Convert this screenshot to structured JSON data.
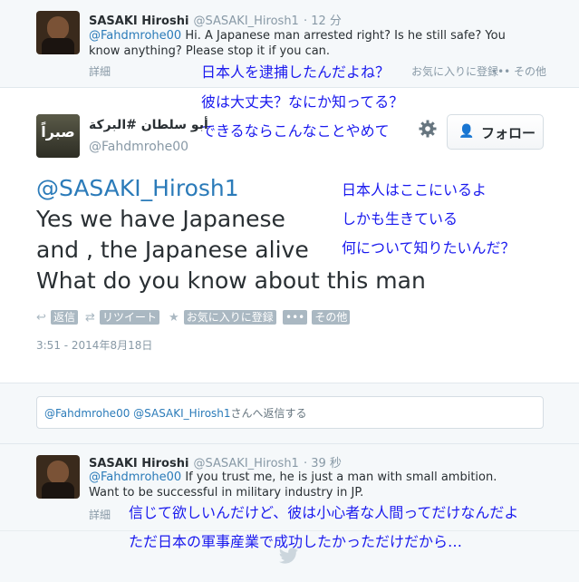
{
  "tweet1": {
    "name": "SASAKI Hiroshi",
    "handle": "@SASAKI_Hirosh1",
    "time": "· 12 分",
    "mention": "@Fahdmrohe00",
    "text": " Hi. A Japanese man arrested right? Is he still safe? You know anything? Please stop it if you can.",
    "details": "詳細",
    "fav_faded": "お気に入りに登録",
    "more_faded": "••• その他"
  },
  "annotation1": [
    "日本人を逮捕したんだよね？",
    "彼は大丈夫？なにか知ってる？",
    "できるならこんなことやめて"
  ],
  "tweet2": {
    "name": "أبو سلطان #البركة",
    "handle": "@Fahdmrohe00",
    "avatar_text": "صبراً",
    "follow_label": "フォロー",
    "mention": "@SASAKI_Hirosh1",
    "lines": [
      "Yes we have Japanese",
      "and , the Japanese alive",
      "What do you know about this man"
    ],
    "actions": {
      "reply": "返信",
      "retweet": "リツイート",
      "favorite": "お気に入りに登録",
      "more": "その他"
    },
    "timestamp": "3:51 - 2014年8月18日"
  },
  "annotation2": [
    "日本人はここにいるよ",
    "しかも生きている",
    "何について知りたいんだ？"
  ],
  "reply_box": {
    "mention1": "@Fahdmrohe00",
    "mention2": "@SASAKI_Hirosh1",
    "suffix": "さんへ返信する"
  },
  "tweet3": {
    "name": "SASAKI Hiroshi",
    "handle": "@SASAKI_Hirosh1",
    "time": "· 39 秒",
    "mention": "@Fahdmrohe00",
    "text": " If you trust me, he is just a man with small ambition. Want to be successful in military industry in JP.",
    "details": "詳細"
  },
  "annotation3": [
    "信じて欲しいんだけど、彼は小心者な人間ってだけなんだよ",
    "ただ日本の軍事産業で成功したかっただけだから…"
  ],
  "colors": {
    "link": "#2b7bb9",
    "annotation": "#1a1aee",
    "pale_bg": "#f5f8fa",
    "border": "#e1e8ed",
    "muted": "#8899a6"
  },
  "icons": [
    "gear-icon",
    "follow-user-icon",
    "reply-icon",
    "retweet-icon",
    "star-icon",
    "more-icon",
    "bird-icon"
  ]
}
